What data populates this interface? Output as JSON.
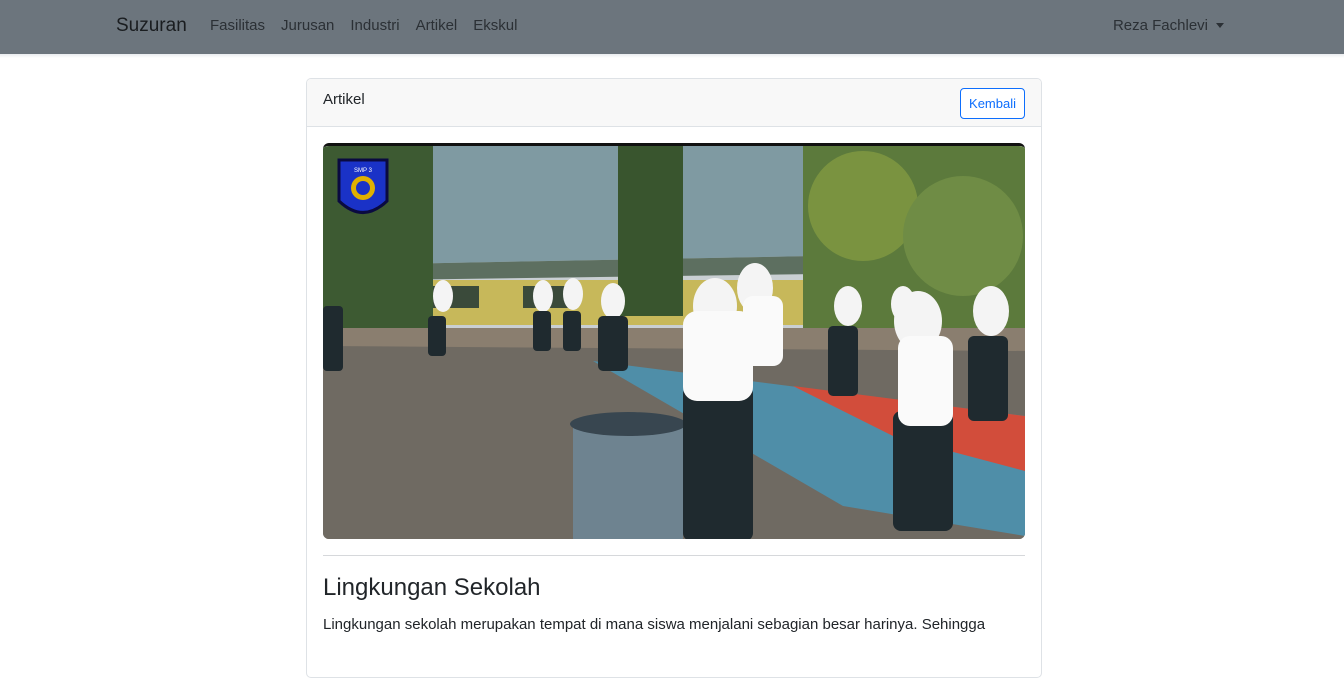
{
  "navbar": {
    "brand": "Suzuran",
    "links": [
      "Fasilitas",
      "Jurusan",
      "Industri",
      "Artikel",
      "Ekskul"
    ],
    "user": "Reza Fachlevi"
  },
  "card": {
    "header_title": "Artikel",
    "back_button": "Kembali"
  },
  "article": {
    "image_logo_text": "SMP 3",
    "title": "Lingkungan Sekolah",
    "body": "Lingkungan sekolah merupakan tempat di mana siswa menjalani sebagian besar harinya. Sehingga"
  }
}
